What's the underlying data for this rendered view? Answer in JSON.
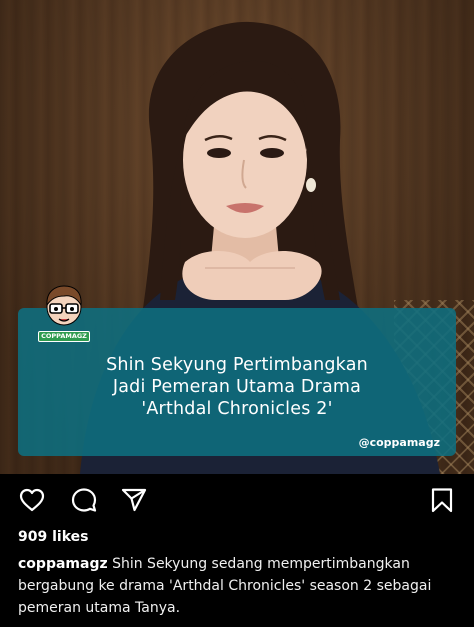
{
  "post": {
    "card": {
      "headline_line1": "Shin Sekyung Pertimbangkan",
      "headline_line2": "Jadi Pemeran Utama Drama",
      "headline_line3": "'Arthdal Chronicles 2'",
      "handle": "@coppamagz",
      "mascot_label": "COPPAMAGZ"
    },
    "actions": {
      "like_icon": "heart-icon",
      "comment_icon": "comment-icon",
      "share_icon": "send-icon",
      "save_icon": "bookmark-icon"
    },
    "likes": "909 likes",
    "caption": {
      "username": "coppamagz",
      "text": "Shin Sekyung sedang mempertimbangkan bergabung ke drama 'Arthdal Chronicles' season 2 sebagai pemeran utama Tanya."
    }
  },
  "colors": {
    "card": "#0e6e80",
    "background": "#000000"
  }
}
